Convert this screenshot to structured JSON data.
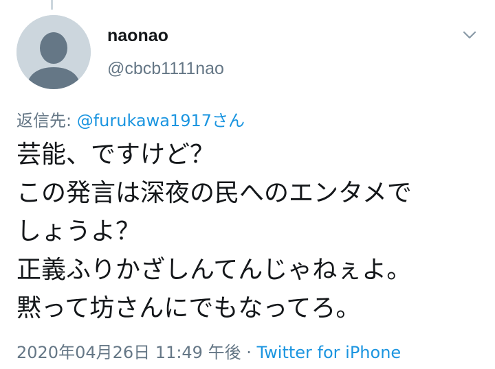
{
  "user": {
    "display_name": "naonao",
    "handle": "@cbcb1111nao"
  },
  "reply": {
    "prefix": "返信先: ",
    "mention": "@furukawa1917さん"
  },
  "tweet": {
    "lines": [
      "芸能、ですけど？",
      "この発言は深夜の民へのエンタメで",
      "しょうよ？",
      "正義ふりかざしんてんじゃねぇよ。",
      "黙って坊さんにでもなってろ。"
    ]
  },
  "meta": {
    "timestamp": "2020年04月26日 11:49 午後",
    "separator": " · ",
    "source": "Twitter for iPhone"
  },
  "icons": {
    "avatar": "default-avatar-icon",
    "menu": "chevron-down-icon"
  },
  "colors": {
    "text_primary": "#14171a",
    "text_secondary": "#657786",
    "link": "#1b95e0",
    "avatar_bg": "#ccd6dd",
    "avatar_figure": "#657786"
  }
}
